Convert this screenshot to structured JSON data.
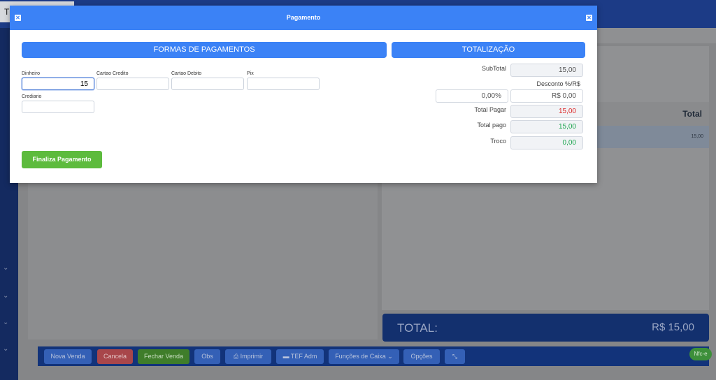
{
  "background": {
    "browser_tab": "T A",
    "table": {
      "total_header": "Total",
      "row_total": "15,00"
    },
    "total_bar": {
      "label": "TOTAL:",
      "value": "R$ 15,00"
    },
    "toolbar": {
      "nova_venda": "Nova Venda",
      "cancela": "Cancela",
      "fechar_venda": "Fechar Venda",
      "obs": "Obs",
      "imprimir": "Imprimir",
      "tef_adm": "TEF Adm",
      "funcoes_caixa": "Funções de Caixa",
      "opcoes": "Opções"
    },
    "nfce_badge": "Nfc-e"
  },
  "modal": {
    "title": "Pagamento",
    "close_icon": "close-icon",
    "formas": {
      "header": "FORMAS DE PAGAMENTOS",
      "fields": [
        {
          "label": "Dinheiro",
          "value": "15",
          "placeholder": ""
        },
        {
          "label": "Cartao Credito",
          "value": "",
          "placeholder": ""
        },
        {
          "label": "Cartao Debito",
          "value": "",
          "placeholder": ""
        },
        {
          "label": "Pix",
          "value": "",
          "placeholder": ""
        },
        {
          "label": "Crediario",
          "value": "",
          "placeholder": ""
        }
      ],
      "finaliza_label": "Finaliza Pagamento"
    },
    "totalizacao": {
      "header": "TOTALIZAÇÃO",
      "subtotal_label": "SubTotal",
      "subtotal_value": "15,00",
      "desconto_label": "Desconto %/R$",
      "desconto_pct": "0,00%",
      "desconto_rs": "R$ 0,00",
      "total_pagar_label": "Total Pagar",
      "total_pagar_value": "15,00",
      "total_pago_label": "Total pago",
      "total_pago_value": "15,00",
      "troco_label": "Troco",
      "troco_value": "0,00"
    }
  },
  "colors": {
    "primary": "#3b82f6",
    "success": "#5dbb3d",
    "danger": "#dc2626",
    "positive": "#16a34a",
    "navy": "#13306e"
  }
}
